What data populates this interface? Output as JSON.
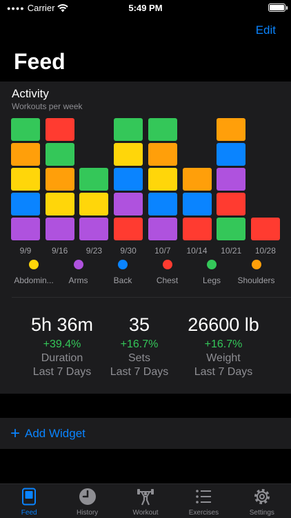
{
  "status_bar": {
    "carrier": "Carrier",
    "time": "5:49 PM"
  },
  "header": {
    "edit_label": "Edit",
    "title": "Feed"
  },
  "activity": {
    "title": "Activity",
    "subtitle": "Workouts per week"
  },
  "colors": {
    "abdominals": "#ffd60a",
    "arms": "#af52de",
    "back": "#0a84ff",
    "chest": "#ff3b30",
    "legs": "#34c759",
    "shoulders": "#ff9f0a",
    "accent": "#0a84ff",
    "positive": "#34c759"
  },
  "chart_data": {
    "type": "bar",
    "stacked": true,
    "title": "Activity",
    "subtitle": "Workouts per week",
    "categories": [
      "9/9",
      "9/16",
      "9/23",
      "9/30",
      "10/7",
      "10/14",
      "10/21",
      "10/28"
    ],
    "series": [
      {
        "name": "Abdominals",
        "key": "abdominals",
        "values": [
          1,
          1,
          0,
          1,
          1,
          0,
          0,
          0
        ]
      },
      {
        "name": "Arms",
        "key": "arms",
        "values": [
          1,
          1,
          1,
          1,
          1,
          0,
          1,
          0
        ]
      },
      {
        "name": "Back",
        "key": "back",
        "values": [
          1,
          0,
          0,
          1,
          1,
          1,
          1,
          0
        ]
      },
      {
        "name": "Chest",
        "key": "chest",
        "values": [
          0,
          1,
          0,
          1,
          0,
          1,
          1,
          1
        ]
      },
      {
        "name": "Legs",
        "key": "legs",
        "values": [
          1,
          1,
          1,
          1,
          1,
          0,
          1,
          0
        ]
      },
      {
        "name": "Shoulders",
        "key": "shoulders",
        "values": [
          1,
          1,
          1,
          0,
          1,
          1,
          1,
          0
        ]
      }
    ],
    "stacks": [
      [
        "arms",
        "back",
        "abdominals",
        "shoulders",
        "legs"
      ],
      [
        "arms",
        "abdominals",
        "shoulders",
        "legs",
        "chest"
      ],
      [
        "arms",
        "abdominals",
        "legs"
      ],
      [
        "chest",
        "arms",
        "back",
        "abdominals",
        "legs"
      ],
      [
        "arms",
        "back",
        "abdominals",
        "shoulders",
        "legs"
      ],
      [
        "chest",
        "back",
        "shoulders"
      ],
      [
        "legs",
        "chest",
        "arms",
        "back",
        "shoulders"
      ],
      [
        "chest"
      ]
    ],
    "legend": [
      {
        "label": "Abdomin...",
        "key": "abdominals"
      },
      {
        "label": "Arms",
        "key": "arms"
      },
      {
        "label": "Back",
        "key": "back"
      },
      {
        "label": "Chest",
        "key": "chest"
      },
      {
        "label": "Legs",
        "key": "legs"
      },
      {
        "label": "Shoulders",
        "key": "shoulders"
      }
    ],
    "legend_placement": "bottom",
    "grid": false
  },
  "stats": [
    {
      "value": "5h 36m",
      "change": "+39.4%",
      "label": "Duration",
      "period": "Last 7 Days"
    },
    {
      "value": "35",
      "change": "+16.7%",
      "label": "Sets",
      "period": "Last 7 Days"
    },
    {
      "value": "26600 lb",
      "change": "+16.7%",
      "label": "Weight",
      "period": "Last 7 Days"
    }
  ],
  "add_widget": {
    "label": "Add Widget"
  },
  "tabs": [
    {
      "label": "Feed",
      "icon": "feed-icon",
      "active": true
    },
    {
      "label": "History",
      "icon": "clock-icon",
      "active": false
    },
    {
      "label": "Workout",
      "icon": "weightlifter-icon",
      "active": false
    },
    {
      "label": "Exercises",
      "icon": "list-icon",
      "active": false
    },
    {
      "label": "Settings",
      "icon": "gear-icon",
      "active": false
    }
  ]
}
